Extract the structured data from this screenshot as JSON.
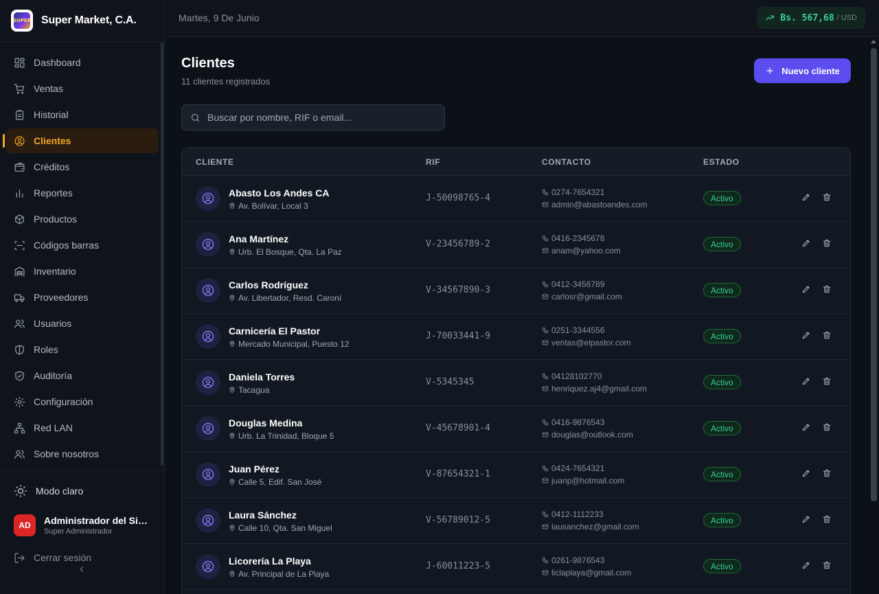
{
  "brand": {
    "name": "Super Market, C.A.",
    "logo_text": "SUPER"
  },
  "nav": [
    {
      "id": "dashboard",
      "label": "Dashboard",
      "icon": "dashboard-icon"
    },
    {
      "id": "ventas",
      "label": "Ventas",
      "icon": "cart-icon"
    },
    {
      "id": "historial",
      "label": "Historial",
      "icon": "clipboard-icon"
    },
    {
      "id": "clientes",
      "label": "Clientes",
      "icon": "user-circle-icon",
      "active": true
    },
    {
      "id": "creditos",
      "label": "Créditos",
      "icon": "wallet-icon"
    },
    {
      "id": "reportes",
      "label": "Reportes",
      "icon": "bar-chart-icon"
    },
    {
      "id": "productos",
      "label": "Productos",
      "icon": "box-icon"
    },
    {
      "id": "codigos",
      "label": "Códigos barras",
      "icon": "scan-icon"
    },
    {
      "id": "inventario",
      "label": "Inventario",
      "icon": "warehouse-icon"
    },
    {
      "id": "proveedores",
      "label": "Proveedores",
      "icon": "truck-icon"
    },
    {
      "id": "usuarios",
      "label": "Usuarios",
      "icon": "users-icon"
    },
    {
      "id": "roles",
      "label": "Roles",
      "icon": "shield-icon"
    },
    {
      "id": "auditoria",
      "label": "Auditoría",
      "icon": "shield-check-icon"
    },
    {
      "id": "configuracion",
      "label": "Configuración",
      "icon": "gear-icon"
    },
    {
      "id": "redlan",
      "label": "Red LAN",
      "icon": "network-icon"
    },
    {
      "id": "sobre",
      "label": "Sobre nosotros",
      "icon": "users-icon"
    }
  ],
  "sidebar_bottom": {
    "mode_label": "Modo claro",
    "user_initials": "AD",
    "user_name": "Administrador del Sistema",
    "user_role": "Super Administrador",
    "logout_label": "Cerrar sesión"
  },
  "topbar": {
    "date": "Martes, 9 De Junio",
    "rate_value": "Bs. 567,68",
    "rate_unit": "/ USD"
  },
  "page": {
    "title": "Clientes",
    "subtitle": "11 clientes registrados",
    "new_button": "Nuevo cliente",
    "search_placeholder": "Buscar por nombre, RIF o email..."
  },
  "table": {
    "headers": {
      "cliente": "CLIENTE",
      "rif": "RIF",
      "contacto": "CONTACTO",
      "estado": "ESTADO"
    },
    "rows": [
      {
        "name": "Abasto Los Andes CA",
        "address": "Av. Bolívar, Local 3",
        "rif": "J-50098765-4",
        "phone": "0274-7654321",
        "email": "admin@abastoandes.com",
        "status": "Activo"
      },
      {
        "name": "Ana Martínez",
        "address": "Urb. El Bosque, Qta. La Paz",
        "rif": "V-23456789-2",
        "phone": "0416-2345678",
        "email": "anam@yahoo.com",
        "status": "Activo"
      },
      {
        "name": "Carlos Rodríguez",
        "address": "Av. Libertador, Resd. Caroní",
        "rif": "V-34567890-3",
        "phone": "0412-3456789",
        "email": "carlosr@gmail.com",
        "status": "Activo"
      },
      {
        "name": "Carnicería El Pastor",
        "address": "Mercado Municipal, Puesto 12",
        "rif": "J-70033441-9",
        "phone": "0251-3344556",
        "email": "ventas@elpastor.com",
        "status": "Activo"
      },
      {
        "name": "Daniela Torres",
        "address": "Tacagua",
        "rif": "V-5345345",
        "phone": "04128102770",
        "email": "henriquez.aj4@gmail.com",
        "status": "Activo"
      },
      {
        "name": "Douglas Medina",
        "address": "Urb. La Trinidad, Bloque 5",
        "rif": "V-45678901-4",
        "phone": "0416-9876543",
        "email": "douglas@outlook.com",
        "status": "Activo"
      },
      {
        "name": "Juan Pérez",
        "address": "Calle 5, Edif. San José",
        "rif": "V-87654321-1",
        "phone": "0424-7654321",
        "email": "juanp@hotmail.com",
        "status": "Activo"
      },
      {
        "name": "Laura Sánchez",
        "address": "Calle 10, Qta. San Miguel",
        "rif": "V-56789012-5",
        "phone": "0412-1112233",
        "email": "lausanchez@gmail.com",
        "status": "Activo"
      },
      {
        "name": "Licorería La Playa",
        "address": "Av. Principal de La Playa",
        "rif": "J-60011223-5",
        "phone": "0261-9876543",
        "email": "liclaplaya@gmail.com",
        "status": "Activo"
      }
    ]
  },
  "colors": {
    "accent": "#f6a623",
    "primary": "#5b4df0",
    "success": "#34d399",
    "danger": "#dc2626"
  }
}
